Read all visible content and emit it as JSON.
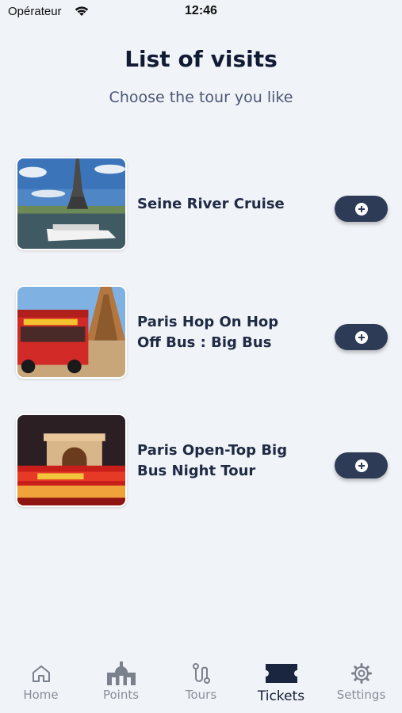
{
  "status_bar": {
    "carrier": "Opérateur",
    "time": "12:46"
  },
  "header": {
    "title": "List of visits",
    "subtitle": "Choose the tour you like"
  },
  "tours": [
    {
      "name": "Seine River Cruise",
      "image": "eiffel-tower-river-boat"
    },
    {
      "name": "Paris Hop On Hop Off Bus : Big Bus",
      "image": "red-double-decker-bus-eiffel"
    },
    {
      "name": "Paris Open-Top Big Bus Night Tour",
      "image": "arc-de-triomphe-night-bus"
    }
  ],
  "tab_bar": {
    "items": [
      {
        "label": "Home",
        "icon": "home-icon"
      },
      {
        "label": "Points",
        "icon": "monument-icon"
      },
      {
        "label": "Tours",
        "icon": "route-icon"
      },
      {
        "label": "Tickets",
        "icon": "ticket-icon"
      },
      {
        "label": "Settings",
        "icon": "gear-icon"
      }
    ],
    "active": "Tickets"
  },
  "colors": {
    "background": "#f0f3f7",
    "primary": "#2e3b57",
    "title": "#111b33",
    "inactive_tab": "#888e99"
  }
}
